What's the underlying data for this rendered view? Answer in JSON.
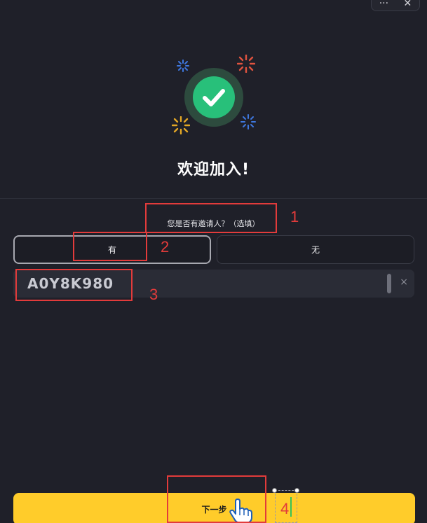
{
  "window": {
    "more_icon": "more-horizontal-icon",
    "more_label": "···",
    "close_icon": "close-icon",
    "close_label": "✕"
  },
  "hero": {
    "icon": "check-circle-icon",
    "title": "欢迎加入!",
    "success_color": "#28c07a"
  },
  "referrer": {
    "prompt": "您是否有邀请人？（选填）",
    "options": [
      {
        "label": "有",
        "selected": true
      },
      {
        "label": "无",
        "selected": false
      }
    ],
    "code_value": "A0Y8K980",
    "clear_label": "×"
  },
  "footer": {
    "next_label": "下一步",
    "accent_color": "#ffcc2a"
  },
  "annotations": {
    "color": "#e23b3b",
    "numbers": [
      "1",
      "2",
      "3",
      "4"
    ]
  }
}
